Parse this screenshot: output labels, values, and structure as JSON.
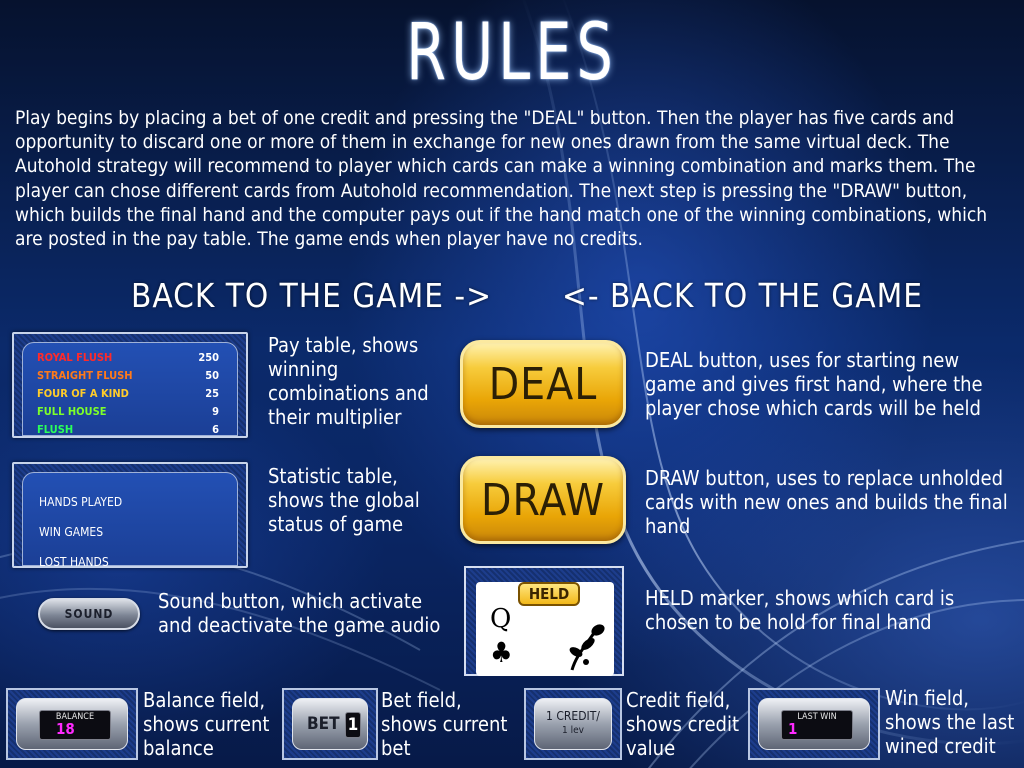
{
  "title": "RULES",
  "intro": "Play begins by placing a bet of one credit and pressing the \"DEAL\" button. Then the player has five cards and opportunity to discard one or more of them in exchange for new ones drawn from the same virtual deck. The Autohold strategy will recommend to player which cards can make a winning combination and marks them. The player can chose different cards from Autohold recommendation. The next step is pressing  the \"DRAW\" button, which builds the final hand and the computer pays out if the hand match one of the winning combinations, which are posted in the pay table. The game ends when player have no credits.",
  "back_left": "BACK TO THE GAME ->",
  "back_right": "<- BACK TO THE GAME",
  "pay_table": {
    "rows": [
      {
        "name": "ROYAL FLUSH",
        "value": "250",
        "color": "#ff2a2a"
      },
      {
        "name": "STRAIGHT FLUSH",
        "value": "50",
        "color": "#ff7a1a"
      },
      {
        "name": "FOUR OF A KIND",
        "value": "25",
        "color": "#ffcc2a"
      },
      {
        "name": "FULL HOUSE",
        "value": "9",
        "color": "#7dff2a"
      },
      {
        "name": "FLUSH",
        "value": "6",
        "color": "#2aff5a"
      }
    ],
    "desc": "Pay table, shows winning combinations and their multiplier"
  },
  "stat_table": {
    "rows": [
      "HANDS PLAYED",
      "WIN GAMES",
      "LOST HANDS"
    ],
    "desc": "Statistic table, shows the global status of game"
  },
  "sound": {
    "label": "SOUND",
    "desc": "Sound button, which activate and deactivate the game audio"
  },
  "deal": {
    "label": "DEAL",
    "desc": "DEAL button, uses for starting new game and gives first hand, where the player chose which cards will be held"
  },
  "draw": {
    "label": "DRAW",
    "desc": "DRAW button, uses to replace unholded cards with new ones and builds the final hand"
  },
  "held": {
    "label": "HELD",
    "card_rank": "Q",
    "card_suit": "♣",
    "desc": "HELD marker, shows which card is chosen to be hold for final hand"
  },
  "balance": {
    "label": "BALANCE",
    "value": "18",
    "desc": "Balance field, shows current balance"
  },
  "bet": {
    "label": "BET",
    "value": "1",
    "desc": "Bet field, shows current bet"
  },
  "credit": {
    "line1": "1 CREDIT/",
    "line2": "1 lev",
    "desc": "Credit field, shows credit value"
  },
  "lastwin": {
    "label": "LAST WIN",
    "value": "1",
    "desc": "Win field, shows the last wined credit"
  },
  "colors": {
    "accent_gold": "#f2b81a",
    "lcd_value": "#ff2aff",
    "background": "#0b2a6b"
  }
}
